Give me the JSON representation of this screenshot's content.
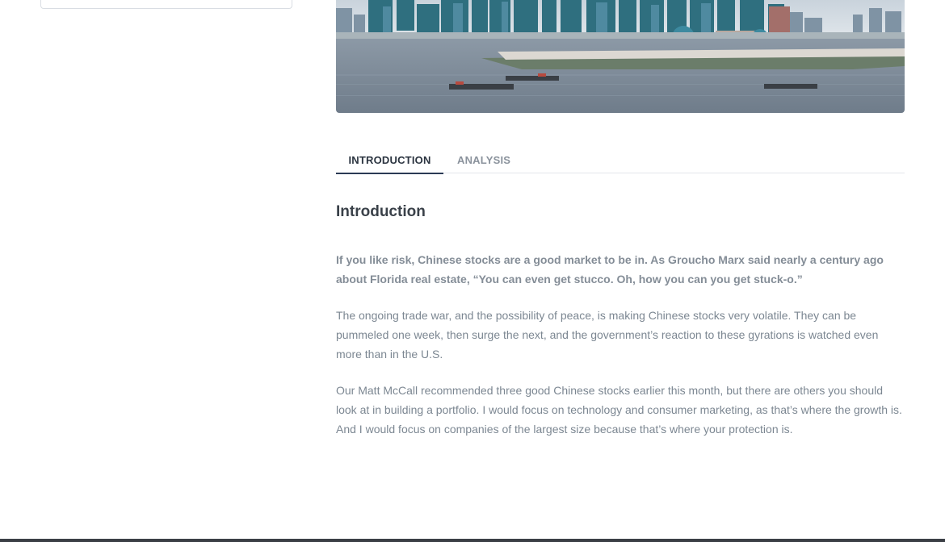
{
  "tabs": [
    {
      "label": "INTRODUCTION",
      "active": true
    },
    {
      "label": "ANALYSIS",
      "active": false
    }
  ],
  "article": {
    "heading": "Introduction",
    "lead": "If you like risk, Chinese stocks are a good market to be in. As Groucho Marx said nearly a century ago about Florida real estate, “You can even get stucco. Oh, how you can you get stuck-o.”",
    "paragraphs": [
      "The ongoing trade war, and the possibility of peace, is making Chinese stocks very volatile. They can be pummeled one week, then surge the next, and the government’s reaction to these gyrations is watched even more than in the U.S.",
      "Our Matt McCall recommended three good Chinese stocks earlier this month, but there are others you should look at in building a portfolio. I would focus on technology and consumer marketing, as that’s where the growth is. And I would focus on companies of the largest size because that’s where your protection is."
    ]
  },
  "colors": {
    "accent": "#2b3a55",
    "text": "#7c8792",
    "heading": "#3a4149"
  }
}
